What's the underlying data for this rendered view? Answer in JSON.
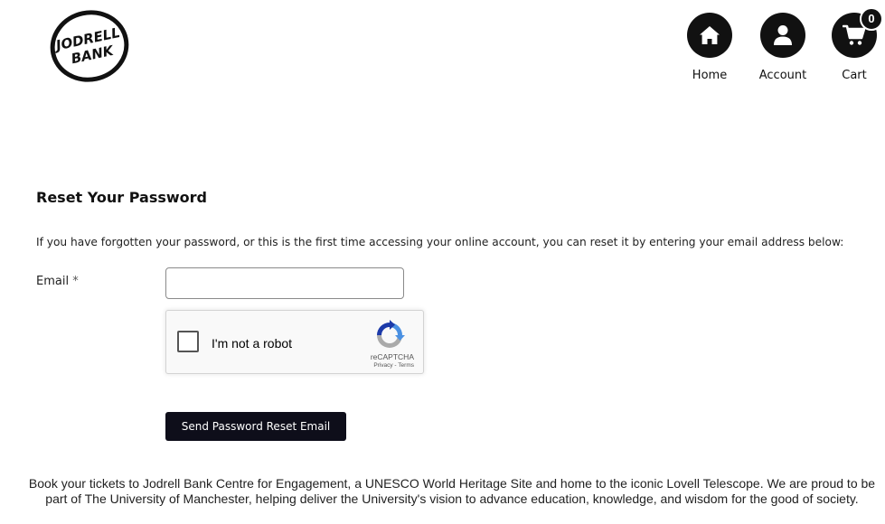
{
  "header": {
    "logo_text_line1": "JODRELL",
    "logo_text_line2": "BANK",
    "nav": [
      {
        "label": "Home",
        "icon": "home-icon"
      },
      {
        "label": "Account",
        "icon": "user-icon"
      },
      {
        "label": "Cart",
        "icon": "cart-icon",
        "badge": "0"
      }
    ]
  },
  "main": {
    "title": "Reset Your Password",
    "intro": "If you have forgotten your password, or this is the first time accessing your online account, you can reset it by entering your email address below:",
    "email_label": "Email",
    "required_mark": "*",
    "email_value": "",
    "recaptcha": {
      "label": "I'm not a robot",
      "brand": "reCAPTCHA",
      "privacy": "Privacy",
      "separator": " - ",
      "terms": "Terms"
    },
    "submit_label": "Send Password Reset Email"
  },
  "footer": {
    "text": "Book your tickets to Jodrell Bank Centre for Engagement, a UNESCO World Heritage Site and home to the iconic Lovell Telescope. We are proud to be part of The University of Manchester, helping deliver the University's vision to advance education, knowledge, and wisdom for the good of society."
  },
  "colors": {
    "button_bg": "#0e0e1a",
    "nav_circle": "#111111",
    "recaptcha_blue": "#1c3aa9",
    "recaptcha_lightblue": "#4a90e2",
    "recaptcha_gray": "#aaaaaa"
  }
}
